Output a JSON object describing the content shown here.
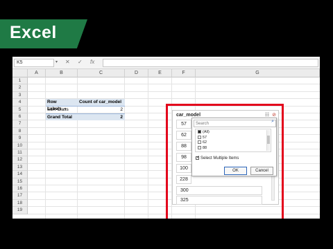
{
  "badge": {
    "label": "Excel",
    "color": "#1f7a45"
  },
  "formula_bar": {
    "name_box": "K5",
    "cancel_icon": "✕",
    "enter_icon": "✓",
    "fx_label": "fx",
    "value": ""
  },
  "columns": [
    "A",
    "B",
    "C",
    "D",
    "E",
    "F",
    "G"
  ],
  "rows": [
    "1",
    "2",
    "3",
    "4",
    "5",
    "6",
    "7",
    "8",
    "9",
    "10",
    "11",
    "12",
    "13",
    "14",
    "15",
    "16",
    "17",
    "18",
    "19"
  ],
  "pivot": {
    "row_labels_header": "Row Labels",
    "count_header": "Count of car_model",
    "rows": [
      {
        "label": "SLK-Class",
        "value": "2"
      }
    ],
    "grand_total_label": "Grand Total",
    "grand_total_value": "2"
  },
  "slicer": {
    "title": "car_model",
    "items": [
      "57",
      "62",
      "88",
      "98",
      "100",
      "228",
      "300",
      "325"
    ]
  },
  "filter_popup": {
    "search_placeholder": "Search",
    "options": [
      {
        "label": "(All)",
        "checked": true
      },
      {
        "label": "57",
        "checked": false
      },
      {
        "label": "62",
        "checked": false
      },
      {
        "label": "88",
        "checked": false
      }
    ],
    "multi_select_label": "Select Multiple Items",
    "ok_label": "OK",
    "cancel_label": "Cancel"
  },
  "highlight_color": "#e3001b"
}
